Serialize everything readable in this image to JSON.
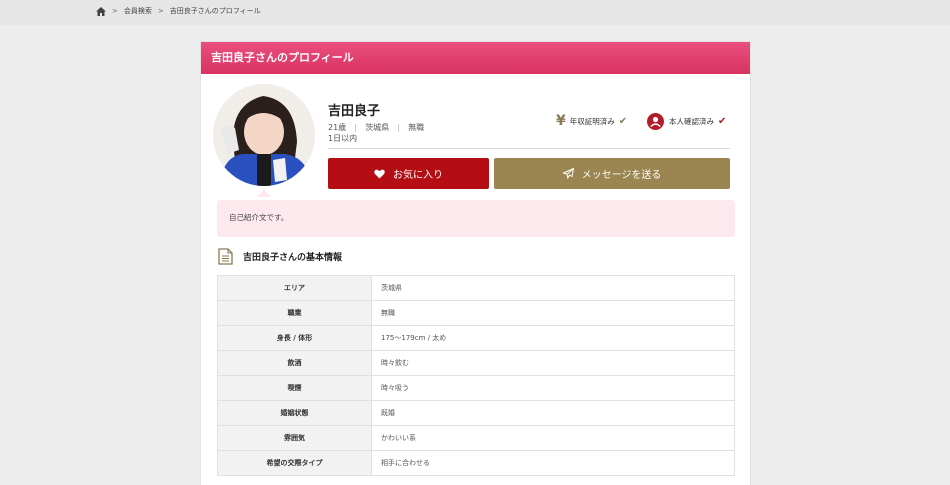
{
  "breadcrumb": {
    "home_icon": "home-icon",
    "separator": ">",
    "items": [
      "会員検索",
      "吉田良子さんのプロフィール"
    ]
  },
  "header": {
    "title": "吉田良子さんのプロフィール"
  },
  "profile": {
    "name": "吉田良子",
    "age": "21歳",
    "area": "茨城県",
    "job": "無職",
    "last_login": "1日以内",
    "verifications": {
      "income": "年収証明済み",
      "identity": "本人確認済み"
    }
  },
  "actions": {
    "favorite_label": "お気に入り",
    "message_label": "メッセージを送る"
  },
  "intro": {
    "text": "自己紹介文です。"
  },
  "basic_info": {
    "title": "吉田良子さんの基本情報",
    "rows": [
      {
        "key": "エリア",
        "value": "茨城県"
      },
      {
        "key": "職業",
        "value": "無職"
      },
      {
        "key": "身長 / 体形",
        "value": "175～179cm / 太め"
      },
      {
        "key": "飲酒",
        "value": "時々飲む"
      },
      {
        "key": "喫煙",
        "value": "時々吸う"
      },
      {
        "key": "婚姻状態",
        "value": "既婚"
      },
      {
        "key": "雰囲気",
        "value": "かわいい系"
      },
      {
        "key": "希望の交際タイプ",
        "value": "相手に合わせる"
      }
    ]
  },
  "colors": {
    "header_gradient_top": "#ea4f7d",
    "header_gradient_bottom": "#d83363",
    "favorite_button": "#b50d14",
    "message_button": "#9b8550",
    "intro_bg": "#fde8ee"
  }
}
